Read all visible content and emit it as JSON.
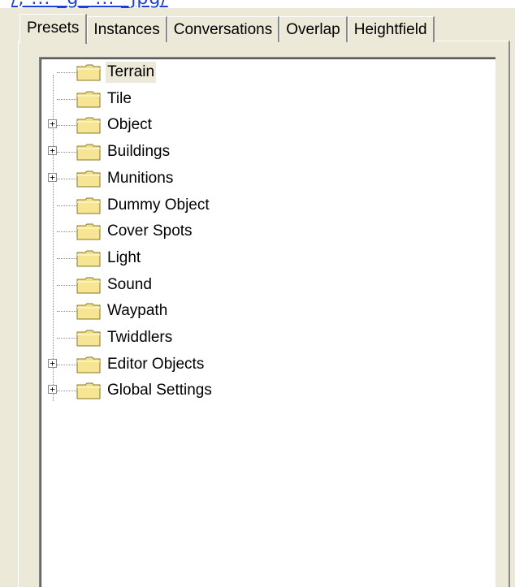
{
  "url_fragment": "/, ...  _g_ ...  _jpg/",
  "tabs": [
    {
      "label": "Presets",
      "active": true
    },
    {
      "label": "Instances"
    },
    {
      "label": "Conversations"
    },
    {
      "label": "Overlap"
    },
    {
      "label": "Heightfield"
    }
  ],
  "tree": {
    "items": [
      {
        "label": "Terrain",
        "expandable": false,
        "selected": true,
        "icon": "folder-icon"
      },
      {
        "label": "Tile",
        "expandable": false,
        "icon": "folder-icon"
      },
      {
        "label": "Object",
        "expandable": true,
        "icon": "folder-icon"
      },
      {
        "label": "Buildings",
        "expandable": true,
        "icon": "folder-icon"
      },
      {
        "label": "Munitions",
        "expandable": true,
        "icon": "folder-icon"
      },
      {
        "label": "Dummy Object",
        "expandable": false,
        "icon": "folder-icon"
      },
      {
        "label": "Cover Spots",
        "expandable": false,
        "icon": "folder-icon"
      },
      {
        "label": "Light",
        "expandable": false,
        "icon": "folder-icon"
      },
      {
        "label": "Sound",
        "expandable": false,
        "icon": "folder-icon"
      },
      {
        "label": "Waypath",
        "expandable": false,
        "icon": "folder-icon"
      },
      {
        "label": "Twiddlers",
        "expandable": false,
        "icon": "folder-icon"
      },
      {
        "label": "Editor Objects",
        "expandable": true,
        "icon": "folder-icon"
      },
      {
        "label": "Global Settings",
        "expandable": true,
        "icon": "folder-icon"
      }
    ],
    "expander_glyph": "+"
  },
  "colors": {
    "dialog_bg": "#ece9d8",
    "folder_fill": "#f2e08a",
    "folder_stroke": "#8a7a2a",
    "link_blue": "#1a3fd6"
  }
}
